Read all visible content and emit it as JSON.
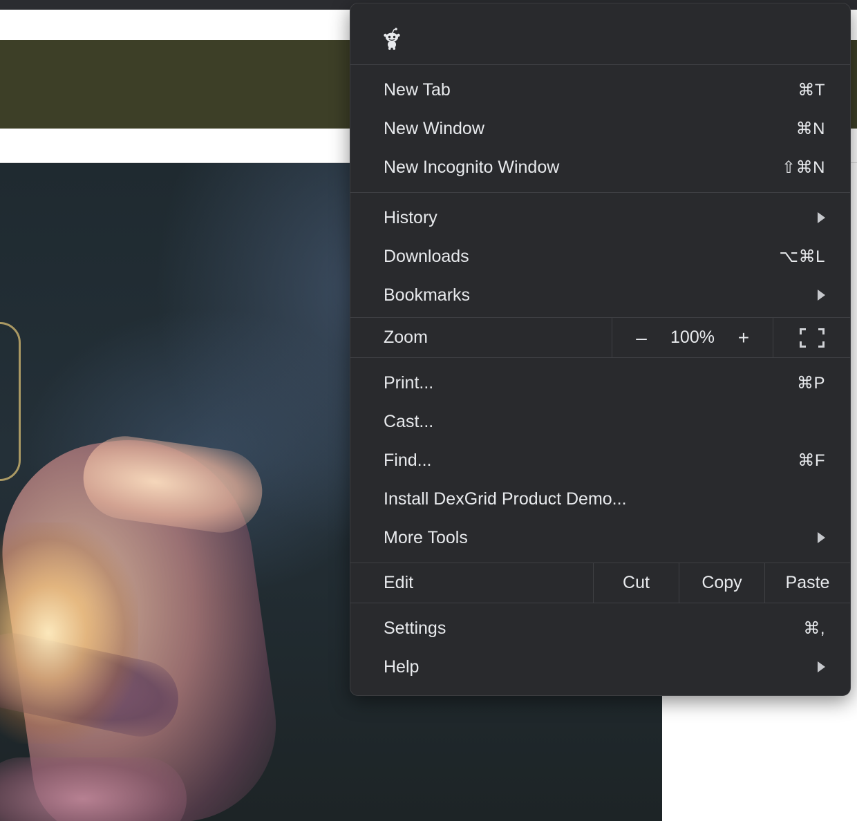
{
  "menu": {
    "profile_icon": "reddit-alien-icon",
    "group1": [
      {
        "label": "New Tab",
        "shortcut": "⌘T"
      },
      {
        "label": "New Window",
        "shortcut": "⌘N"
      },
      {
        "label": "New Incognito Window",
        "shortcut": "⇧⌘N"
      }
    ],
    "group2": [
      {
        "label": "History",
        "submenu": true
      },
      {
        "label": "Downloads",
        "shortcut": "⌥⌘L"
      },
      {
        "label": "Bookmarks",
        "submenu": true
      }
    ],
    "zoom": {
      "label": "Zoom",
      "minus": "–",
      "value": "100%",
      "plus": "+",
      "fullscreen_icon": "fullscreen-icon"
    },
    "group3": [
      {
        "label": "Print...",
        "shortcut": "⌘P"
      },
      {
        "label": "Cast..."
      },
      {
        "label": "Find...",
        "shortcut": "⌘F"
      },
      {
        "label": "Install DexGrid Product Demo..."
      },
      {
        "label": "More Tools",
        "submenu": true
      }
    ],
    "edit": {
      "label": "Edit",
      "cut": "Cut",
      "copy": "Copy",
      "paste": "Paste"
    },
    "group4": [
      {
        "label": "Settings",
        "shortcut": "⌘,"
      },
      {
        "label": "Help",
        "submenu": true
      }
    ]
  },
  "colors": {
    "menu_bg": "#292a2d",
    "menu_text": "#e8eaed",
    "divider": "#3f4044",
    "page_band": "#3d3f27"
  }
}
